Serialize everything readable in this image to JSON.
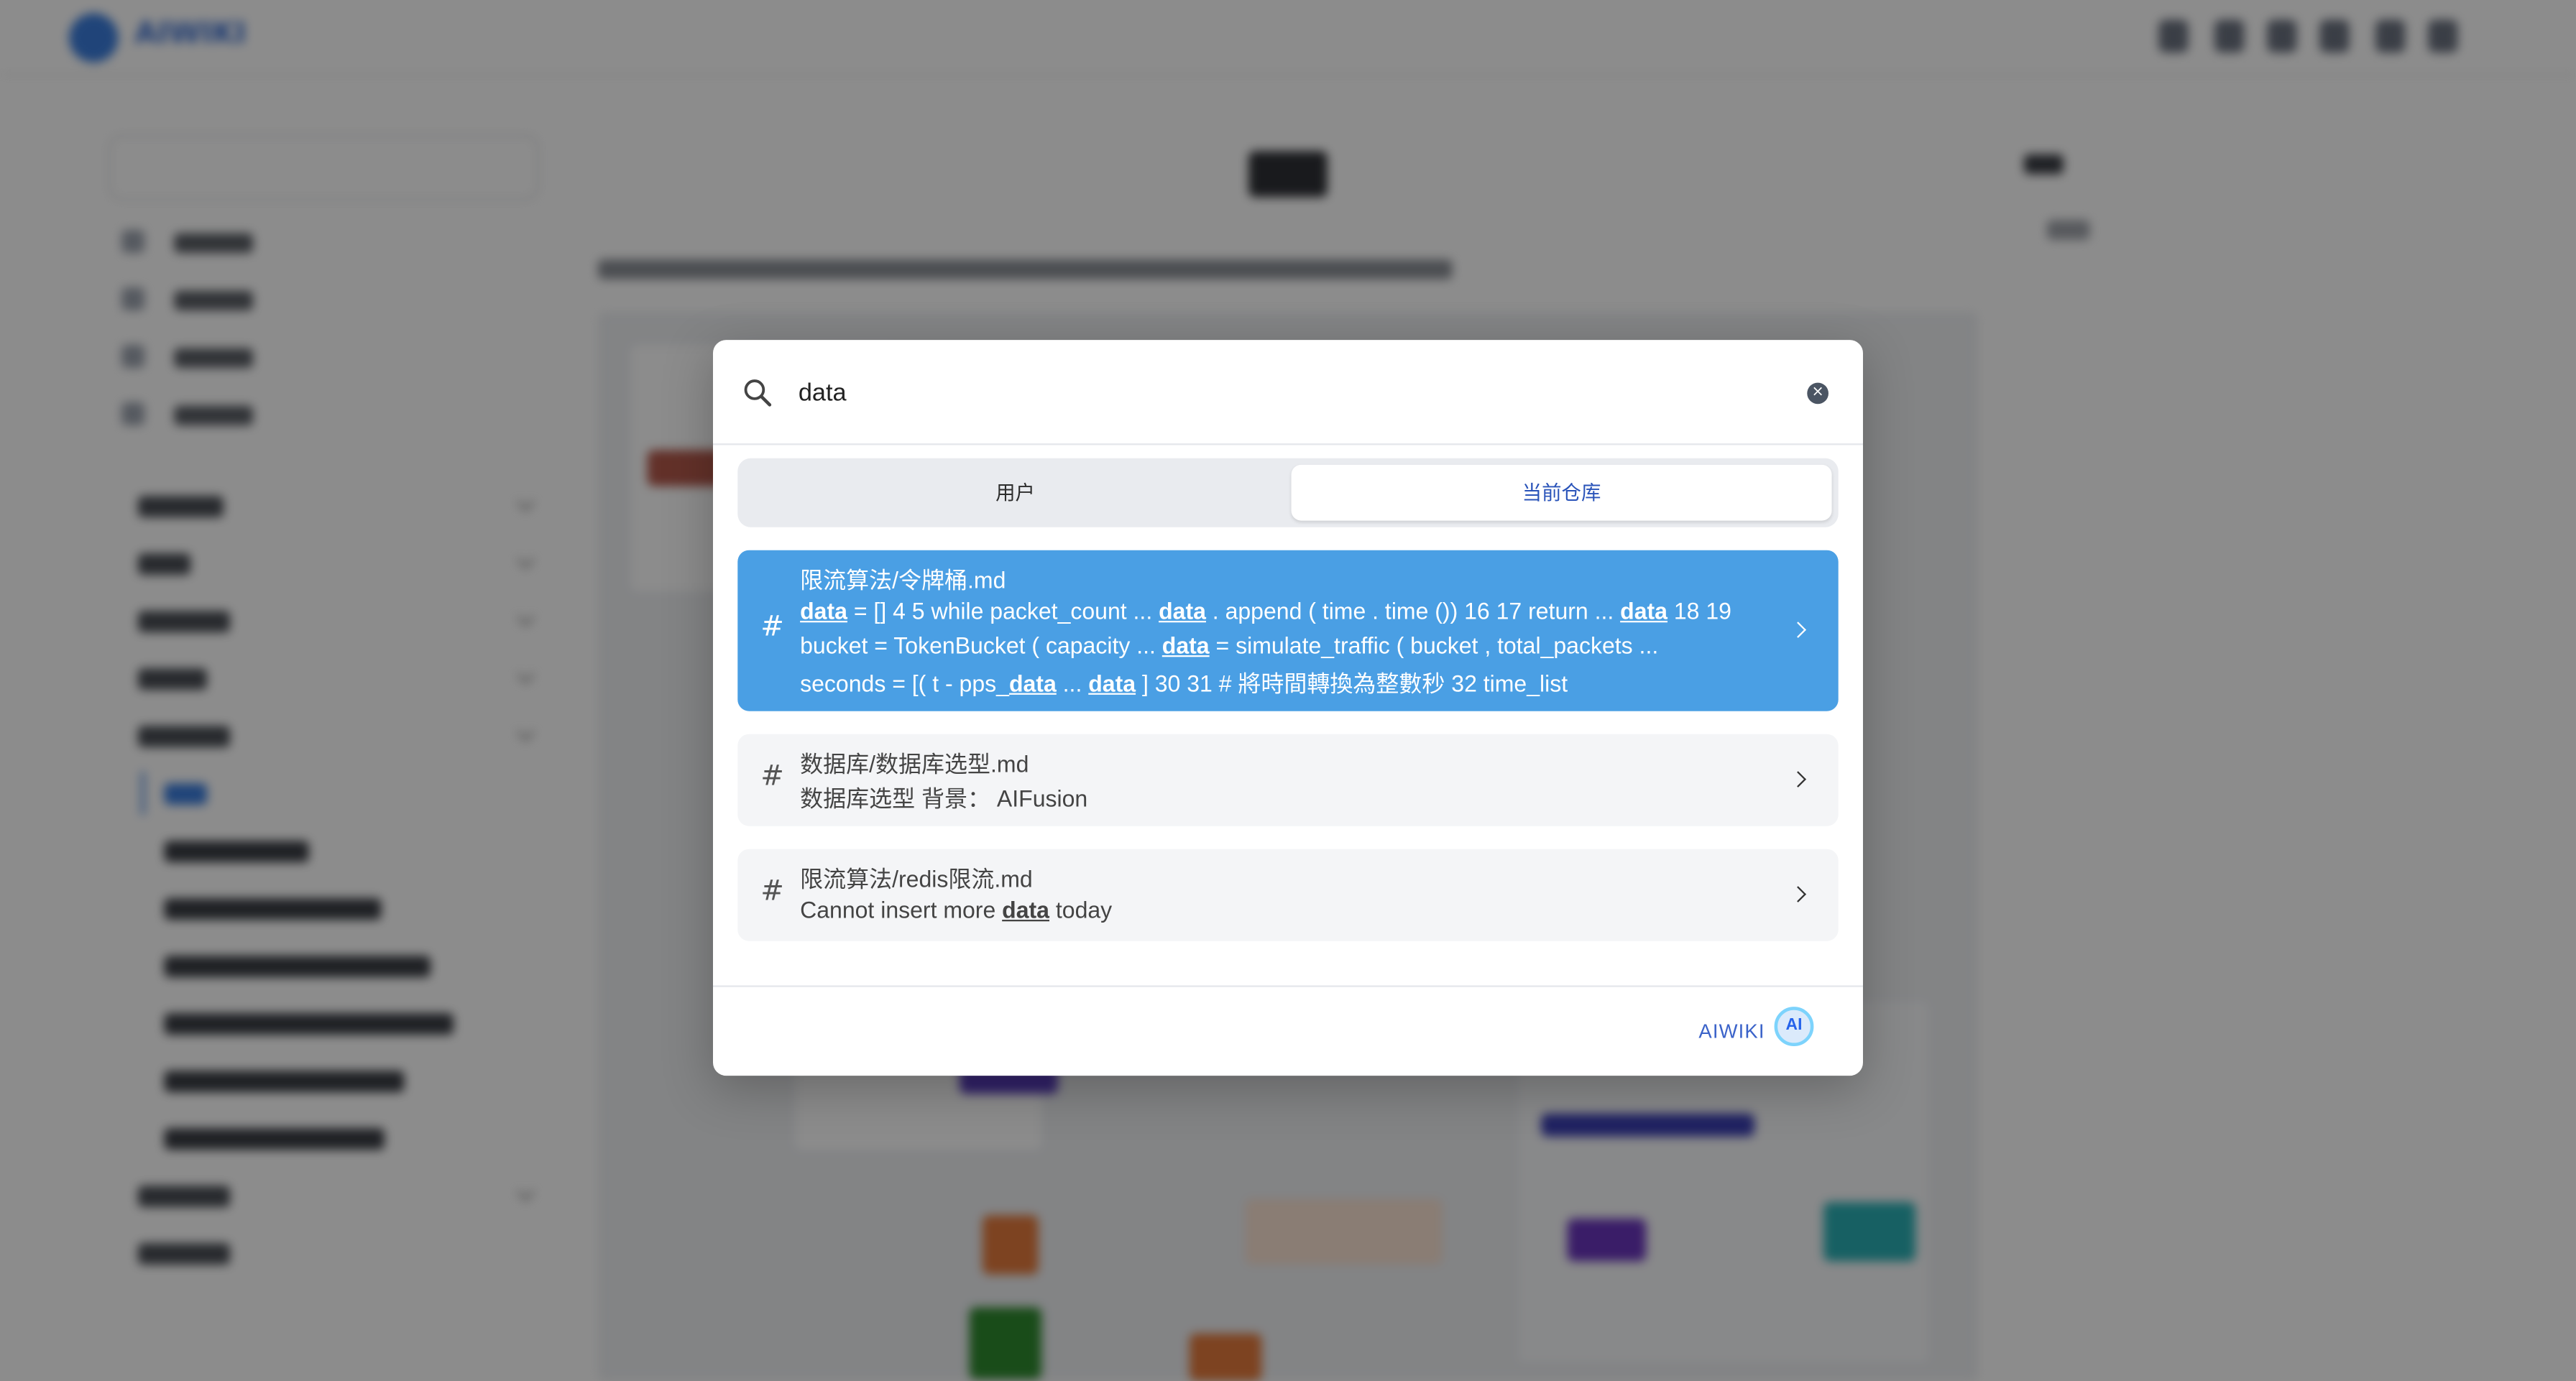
{
  "app": {
    "brand": "AIWIKI"
  },
  "search": {
    "query": "data",
    "clear_label": "×"
  },
  "tabs": [
    {
      "label": "用户",
      "active": false
    },
    {
      "label": "当前仓库",
      "active": true
    }
  ],
  "results": [
    {
      "title": "限流算法/令牌桶.md",
      "lines": [
        [
          {
            "t": "data",
            "h": true
          },
          {
            "t": " = [] 4 5 while packet_count ... ",
            "h": false
          },
          {
            "t": "data",
            "h": true
          },
          {
            "t": " . append ( time . time ()) 16 17 return ... ",
            "h": false
          },
          {
            "t": "data",
            "h": true
          },
          {
            "t": " 18 19",
            "h": false
          }
        ],
        [
          {
            "t": "bucket = TokenBucket ( capacity ... ",
            "h": false
          },
          {
            "t": "data",
            "h": true
          },
          {
            "t": " = simulate_traffic ( bucket , total_packets ...",
            "h": false
          }
        ],
        [
          {
            "t": "seconds = [( t - pps_",
            "h": false
          },
          {
            "t": "data",
            "h": true
          },
          {
            "t": " ... ",
            "h": false
          },
          {
            "t": "data",
            "h": true
          },
          {
            "t": " ] 30 31 # 將時間轉換為整數秒 32 time_list",
            "h": false
          }
        ]
      ],
      "selected": true
    },
    {
      "title": "数据库/数据库选型.md",
      "lines": [
        [
          {
            "t": "数据库选型 背景：  AIFusion",
            "h": false
          }
        ]
      ],
      "selected": false
    },
    {
      "title": "限流算法/redis限流.md",
      "lines": [
        [
          {
            "t": "Cannot insert more ",
            "h": false
          },
          {
            "t": "data",
            "h": true
          },
          {
            "t": " today",
            "h": false
          }
        ]
      ],
      "selected": false
    }
  ],
  "footer": {
    "brand": "AIWIKI",
    "logo_text": "AI"
  },
  "result_icon": "hash-icon",
  "colors": {
    "selected": "#4a9fe4",
    "accent": "#2953b9",
    "overlay": "rgba(0,0,0,0.45)"
  }
}
